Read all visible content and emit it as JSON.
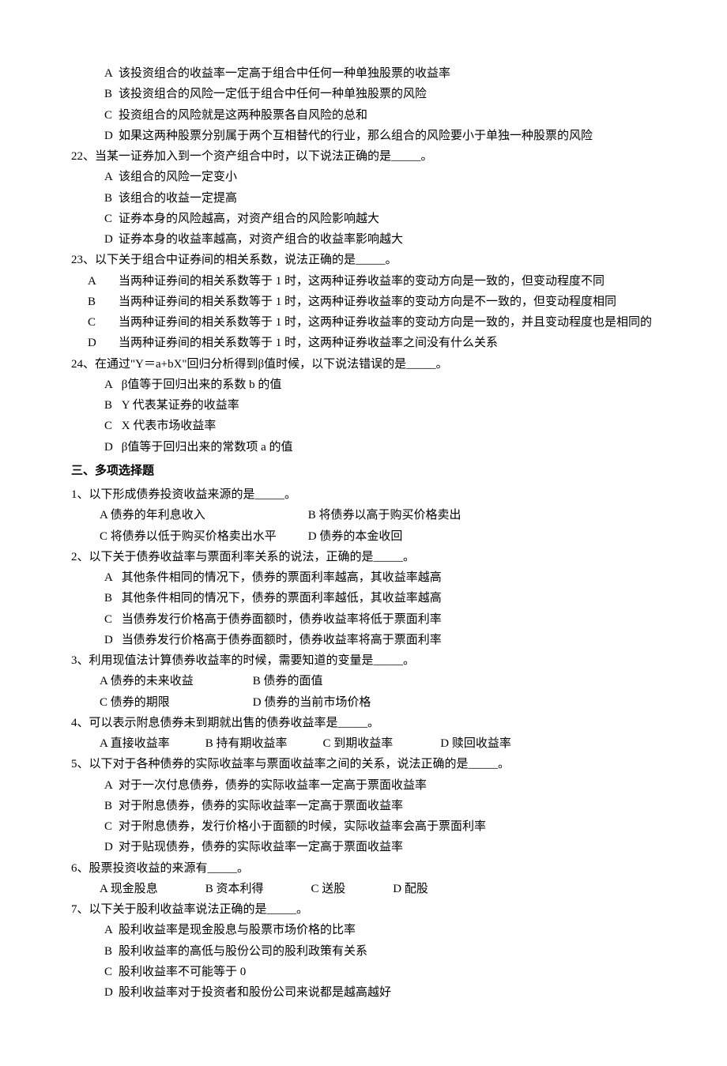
{
  "prev": {
    "opts": [
      {
        "l": "A",
        "t": "该投资组合的收益率一定高于组合中任何一种单独股票的收益率"
      },
      {
        "l": "B",
        "t": "该投资组合的风险一定低于组合中任何一种单独股票的风险"
      },
      {
        "l": "C",
        "t": "投资组合的风险就是这两种股票各自风险的总和"
      },
      {
        "l": "D",
        "t": "如果这两种股票分别属于两个互相替代的行业，那么组合的风险要小于单独一种股票的风险"
      }
    ]
  },
  "q22": {
    "stem": "22、当某一证券加入到一个资产组合中时，以下说法正确的是_____。",
    "opts": [
      {
        "l": "A",
        "t": "该组合的风险一定变小"
      },
      {
        "l": "B",
        "t": "该组合的收益一定提高"
      },
      {
        "l": "C",
        "t": "证券本身的风险越高，对资产组合的风险影响越大"
      },
      {
        "l": "D",
        "t": "证券本身的收益率越高，对资产组合的收益率影响越大"
      }
    ]
  },
  "q23": {
    "stem": "23、以下关于组合中证券间的相关系数，说法正确的是_____。",
    "opts": [
      {
        "l": "A",
        "t": "当两种证券间的相关系数等于 1 时，这两种证券收益率的变动方向是一致的，但变动程度不同"
      },
      {
        "l": "B",
        "t": "当两种证券间的相关系数等于 1 时，这两种证券收益率的变动方向是不一致的，但变动程度相同"
      },
      {
        "l": "C",
        "t": "当两种证券间的相关系数等于 1 时，这两种证券收益率的变动方向是一致的，并且变动程度也是相同的"
      },
      {
        "l": "D",
        "t": "当两种证券间的相关系数等于 1 时，这两种证券收益率之间没有什么关系"
      }
    ]
  },
  "q24": {
    "stem": "24、在通过\"Y＝a+bX\"回归分析得到β值时候，以下说法错误的是_____。",
    "opts": [
      {
        "l": "A",
        "t": "β值等于回归出来的系数 b 的值"
      },
      {
        "l": "B",
        "t": "Y 代表某证券的收益率"
      },
      {
        "l": "C",
        "t": "X 代表市场收益率"
      },
      {
        "l": "D",
        "t": "β值等于回归出来的常数项 a 的值"
      }
    ]
  },
  "section3": "三、多项选择题",
  "m1": {
    "stem": "1、以下形成债券投资收益来源的是_____。",
    "row1a": "A 债券的年利息收入",
    "row1b": "B 将债券以高于购买价格卖出",
    "row2a": "C 将债券以低于购买价格卖出水平",
    "row2b": "D 债券的本金收回"
  },
  "m2": {
    "stem": "2、以下关于债券收益率与票面利率关系的说法，正确的是_____。",
    "opts": [
      {
        "l": "A",
        "t": "其他条件相同的情况下，债券的票面利率越高，其收益率越高"
      },
      {
        "l": "B",
        "t": "其他条件相同的情况下，债券的票面利率越低，其收益率越高"
      },
      {
        "l": "C",
        "t": "当债券发行价格高于债券面额时，债券收益率将低于票面利率"
      },
      {
        "l": "D",
        "t": "当债券发行价格高于债券面额时，债券收益率将高于票面利率"
      }
    ]
  },
  "m3": {
    "stem": "3、利用现值法计算债券收益率的时候，需要知道的变量是_____。",
    "row1a": "A 债券的未来收益",
    "row1b": "B 债券的面值",
    "row2a": "C 债券的期限",
    "row2b": "D 债券的当前市场价格"
  },
  "m4": {
    "stem": "4、可以表示附息债券未到期就出售的债券收益率是_____。",
    "a": "A 直接收益率",
    "b": "B 持有期收益率",
    "c": "C 到期收益率",
    "d": "D 赎回收益率"
  },
  "m5": {
    "stem": "5、以下对于各种债券的实际收益率与票面收益率之间的关系，说法正确的是_____。",
    "opts": [
      {
        "l": "A",
        "t": "对于一次付息债券，债券的实际收益率一定高于票面收益率"
      },
      {
        "l": "B",
        "t": "对于附息债券，债券的实际收益率一定高于票面收益率"
      },
      {
        "l": "C",
        "t": "对于附息债券，发行价格小于面额的时候，实际收益率会高于票面利率"
      },
      {
        "l": "D",
        "t": "对于贴现债券，债券的实际收益率一定高于票面收益率"
      }
    ]
  },
  "m6": {
    "stem": "6、股票投资收益的来源有_____。",
    "a": "A 现金股息",
    "b": "B 资本利得",
    "c": "C 送股",
    "d": "D 配股"
  },
  "m7": {
    "stem": "7、以下关于股利收益率说法正确的是_____。",
    "opts": [
      {
        "l": "A",
        "t": "股利收益率是现金股息与股票市场价格的比率"
      },
      {
        "l": "B",
        "t": "股利收益率的高低与股份公司的股利政策有关系"
      },
      {
        "l": "C",
        "t": "股利收益率不可能等于 0"
      },
      {
        "l": "D",
        "t": "股利收益率对于投资者和股份公司来说都是越高越好"
      }
    ]
  }
}
